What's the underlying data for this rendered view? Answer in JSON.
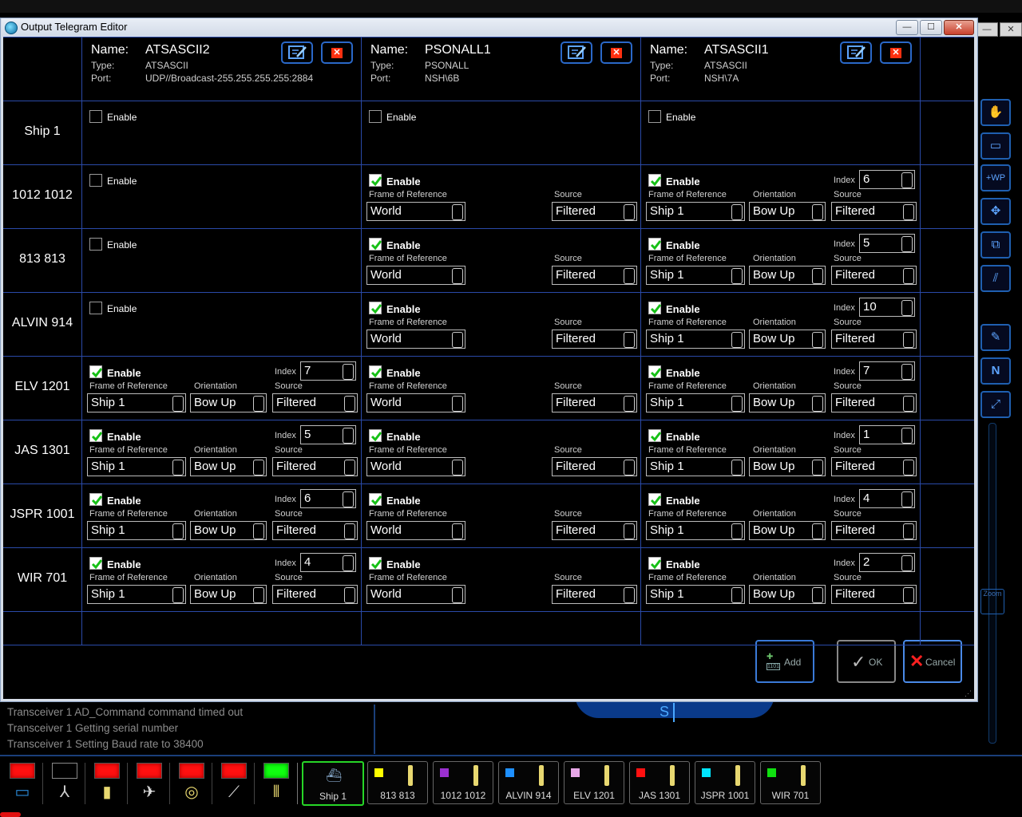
{
  "dialog": {
    "title": "Output Telegram Editor",
    "window_controls": {
      "minimize": "—",
      "maximize": "☐",
      "close": "✕"
    }
  },
  "labels": {
    "name": "Name:",
    "type": "Type:",
    "port": "Port:",
    "enable": "Enable",
    "frame_of_reference": "Frame of Reference",
    "orientation": "Orientation",
    "source": "Source",
    "index": "Index"
  },
  "telegrams": [
    {
      "name": "ATSASCII2",
      "type": "ATSASCII",
      "port": "UDP//Broadcast-255.255.255.255:2884"
    },
    {
      "name": "PSONALL1",
      "type": "PSONALL",
      "port": "NSH\\6B"
    },
    {
      "name": "ATSASCII1",
      "type": "ATSASCII",
      "port": "NSH\\7A"
    }
  ],
  "rows": [
    {
      "label": "Ship 1",
      "cells": [
        {
          "enabled": false
        },
        {
          "enabled": false
        },
        {
          "enabled": false
        }
      ]
    },
    {
      "label": "1012 1012",
      "cells": [
        {
          "enabled": false
        },
        {
          "enabled": true,
          "frame": "World",
          "source": "Filtered"
        },
        {
          "enabled": true,
          "frame": "Ship 1",
          "orientation": "Bow Up",
          "source": "Filtered",
          "index": "6"
        }
      ]
    },
    {
      "label": "813 813",
      "cells": [
        {
          "enabled": false
        },
        {
          "enabled": true,
          "frame": "World",
          "source": "Filtered"
        },
        {
          "enabled": true,
          "frame": "Ship 1",
          "orientation": "Bow Up",
          "source": "Filtered",
          "index": "5"
        }
      ]
    },
    {
      "label": "ALVIN 914",
      "cells": [
        {
          "enabled": false
        },
        {
          "enabled": true,
          "frame": "World",
          "source": "Filtered"
        },
        {
          "enabled": true,
          "frame": "Ship 1",
          "orientation": "Bow Up",
          "source": "Filtered",
          "index": "10"
        }
      ]
    },
    {
      "label": "ELV 1201",
      "cells": [
        {
          "enabled": true,
          "frame": "Ship 1",
          "orientation": "Bow Up",
          "source": "Filtered",
          "index": "7"
        },
        {
          "enabled": true,
          "frame": "World",
          "source": "Filtered"
        },
        {
          "enabled": true,
          "frame": "Ship 1",
          "orientation": "Bow Up",
          "source": "Filtered",
          "index": "7"
        }
      ]
    },
    {
      "label": "JAS 1301",
      "cells": [
        {
          "enabled": true,
          "frame": "Ship 1",
          "orientation": "Bow Up",
          "source": "Filtered",
          "index": "5"
        },
        {
          "enabled": true,
          "frame": "World",
          "source": "Filtered"
        },
        {
          "enabled": true,
          "frame": "Ship 1",
          "orientation": "Bow Up",
          "source": "Filtered",
          "index": "1"
        }
      ]
    },
    {
      "label": "JSPR 1001",
      "cells": [
        {
          "enabled": true,
          "frame": "Ship 1",
          "orientation": "Bow Up",
          "source": "Filtered",
          "index": "6"
        },
        {
          "enabled": true,
          "frame": "World",
          "source": "Filtered"
        },
        {
          "enabled": true,
          "frame": "Ship 1",
          "orientation": "Bow Up",
          "source": "Filtered",
          "index": "4"
        }
      ]
    },
    {
      "label": "WIR 701",
      "cells": [
        {
          "enabled": true,
          "frame": "Ship 1",
          "orientation": "Bow Up",
          "source": "Filtered",
          "index": "4"
        },
        {
          "enabled": true,
          "frame": "World",
          "source": "Filtered"
        },
        {
          "enabled": true,
          "frame": "Ship 1",
          "orientation": "Bow Up",
          "source": "Filtered",
          "index": "2"
        }
      ]
    }
  ],
  "footer": {
    "add": "Add",
    "ok": "OK",
    "cancel": "Cancel",
    "add_icon_text": "1101"
  },
  "log": [
    "Transceiver 1 AD_Command command timed out",
    "Transceiver 1 Getting serial number",
    "Transceiver 1 Setting Baud rate to 38400"
  ],
  "compass": {
    "heading_label": "S"
  },
  "right_toolbar": {
    "items": [
      "hand-icon",
      "ruler-icon",
      "add-waypoint-icon",
      "pan-icon",
      "add-target-icon",
      "measure-icon",
      "edit-icon",
      "north-up-icon",
      "fit-view-icon"
    ],
    "waypoint_text": "+WP",
    "north_text": "N",
    "zoom_label": "Zoom"
  },
  "device_bar": {
    "devices": [
      {
        "icon": "transceiver-icon",
        "status": "red",
        "color": "#ff1010"
      },
      {
        "icon": "sensor-tripod-icon",
        "status": "off",
        "color": "#000000"
      },
      {
        "icon": "battery-icon",
        "status": "red",
        "color": "#ff1010"
      },
      {
        "icon": "satellite-icon",
        "status": "red",
        "color": "#ff1010"
      },
      {
        "icon": "compass-icon",
        "status": "red",
        "color": "#ff1010"
      },
      {
        "icon": "motion-sensor-icon",
        "status": "red",
        "color": "#ff1010"
      },
      {
        "icon": "transponders-icon",
        "status": "green",
        "color": "#10ff10"
      }
    ],
    "targets": [
      {
        "label": "Ship 1",
        "color": null,
        "selected": true
      },
      {
        "label": "813 813",
        "color": "#ffff00",
        "selected": false
      },
      {
        "label": "1012 1012",
        "color": "#9b30d0",
        "selected": false
      },
      {
        "label": "ALVIN 914",
        "color": "#1e90ff",
        "selected": false
      },
      {
        "label": "ELV 1201",
        "color": "#e8a8e8",
        "selected": false
      },
      {
        "label": "JAS 1301",
        "color": "#ff1010",
        "selected": false
      },
      {
        "label": "JSPR 1001",
        "color": "#00e5ff",
        "selected": false
      },
      {
        "label": "WIR 701",
        "color": "#10e010",
        "selected": false
      }
    ]
  },
  "colors": {
    "grid": "#2a4aa8",
    "button_border": "#2a68c8",
    "check_green": "#16c016"
  }
}
